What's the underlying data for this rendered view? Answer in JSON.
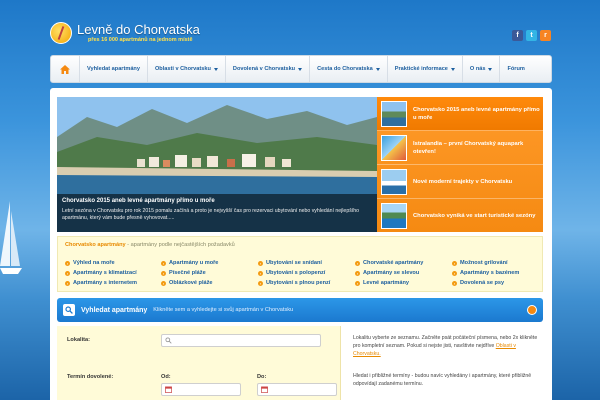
{
  "header": {
    "title": "Levně do Chorvatska",
    "subtitle": "přes 16 000 apartmánů na jednom místě",
    "social": [
      {
        "icon": "facebook-icon",
        "label": "f",
        "color": "#3b5998"
      },
      {
        "icon": "twitter-icon",
        "label": "t",
        "color": "#33ccff"
      },
      {
        "icon": "rss-icon",
        "label": "r",
        "color": "#f78422"
      }
    ]
  },
  "nav": {
    "items": [
      {
        "label": "Vyhledat apartmány",
        "dropdown": false
      },
      {
        "label": "Oblasti v Chorvatsku",
        "dropdown": true
      },
      {
        "label": "Dovolená v Chorvatsku",
        "dropdown": true
      },
      {
        "label": "Cesta do Chorvatska",
        "dropdown": true
      },
      {
        "label": "Praktické informace",
        "dropdown": true
      },
      {
        "label": "O nás",
        "dropdown": true
      },
      {
        "label": "Fórum",
        "dropdown": false
      }
    ]
  },
  "slider": {
    "title": "Chorvatsko 2015 aneb levné apartmány přímo u moře",
    "text": "Letní sezóna v Chorvatsku pro rok 2015 pomalu začíná a proto je nejvyšší čas pro rezervaci ubytování nebo vyhledání nejlepšího apartmánu, který vám bude přesně vyhovovat.....",
    "thumbs": [
      {
        "label": "Chorvatsko 2015 aneb levné apartmány přímo u moře"
      },
      {
        "label": "Istralandia – první Chorvatský aquapark otevřen!"
      },
      {
        "label": "Nové moderní trajekty v Chorvatsku"
      },
      {
        "label": "Chorvatsko vyniká ve start turistické sezóny"
      }
    ]
  },
  "filters": {
    "heading": "Chorvatsko apartmány",
    "subheading": " - apartmány podle nejčastějších požadavků",
    "columns": [
      [
        "Výhled na moře",
        "Apartmány s klimatizací",
        "Apartmány s internetem"
      ],
      [
        "Apartmány u moře",
        "Písečné pláže",
        "Oblázkové pláže"
      ],
      [
        "Ubytování se snídaní",
        "Ubytování s polopenzí",
        "Ubytování s plnou penzí"
      ],
      [
        "Chorvatské apartmány",
        "Apartmány se slevou",
        "Levné apartmány"
      ],
      [
        "Možnost grilování",
        "Apartmány s bazénem",
        "Dovolená se psy"
      ]
    ]
  },
  "search": {
    "title": "Vyhledat apartmány",
    "description": "Klikněte sem a vyhledejte si svůj apartmán v Chorvatsku",
    "location_label": "Lokalita:",
    "term_label": "Termín dovolené:",
    "from_label": "Od:",
    "to_label": "Do:",
    "help1": "Lokalitu vyberte ze seznamu. Začněte psát počáteční písmena, nebo 2x klikněte pro kompletní seznam. Pokud si nejste jisti, navštivte nejdříve",
    "help1_link": "Oblasti v Chorvatsku.",
    "help2": "Hledat i přibližné termíny - budou navíc vyhledány i apartmány, které přibližně odpovídají zadanému termínu."
  }
}
